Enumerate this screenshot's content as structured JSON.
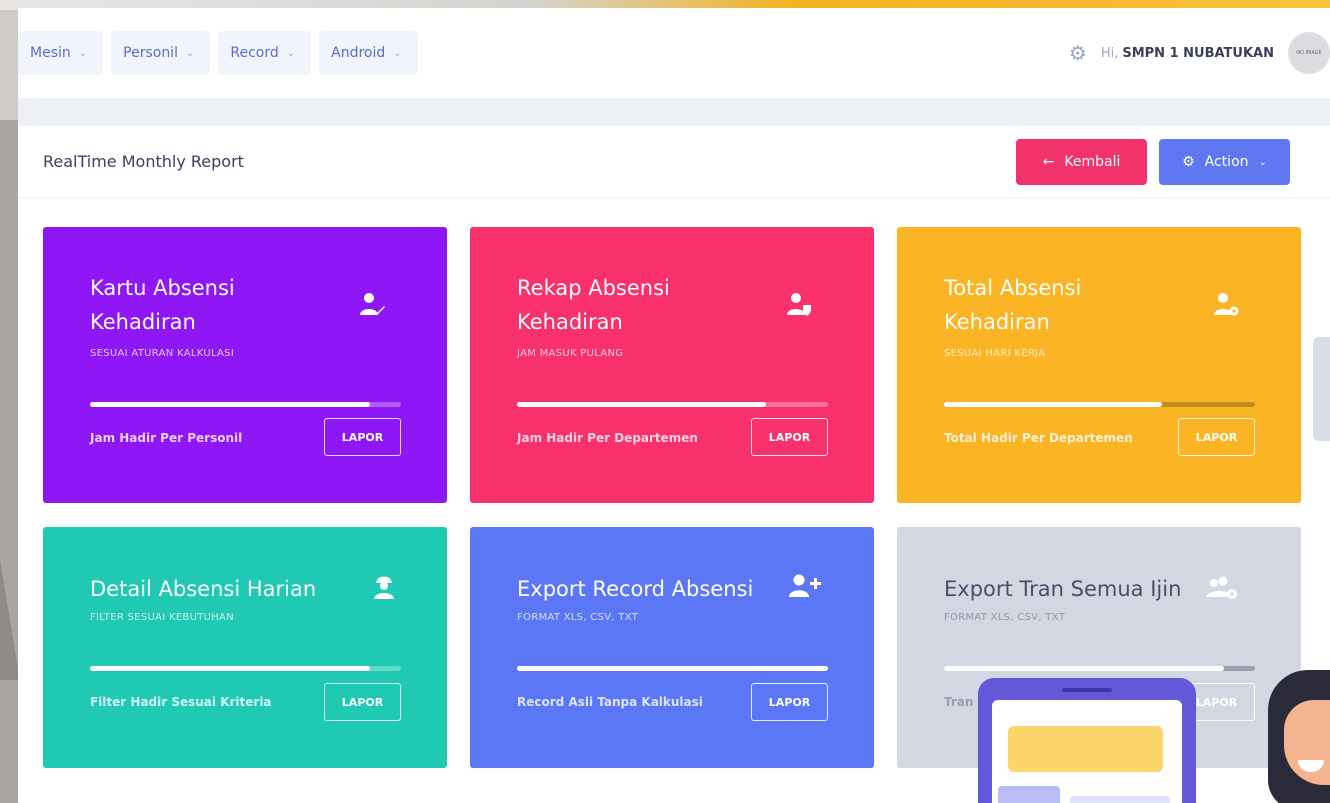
{
  "nav": {
    "menu": [
      {
        "label": "Mesin"
      },
      {
        "label": "Personil"
      },
      {
        "label": "Record"
      },
      {
        "label": "Android"
      }
    ],
    "greeting": "Hi,",
    "user_name": "SMPN 1 NUBATUKAN",
    "avatar_text": "NO IMAGE"
  },
  "page": {
    "title": "RealTime Monthly Report",
    "back_label": "Kembali",
    "action_label": "Action"
  },
  "cards": [
    {
      "title_line1": "Kartu Absensi",
      "title_line2": "Kehadiran",
      "subtitle": "SESUAI ATURAN KALKULASI",
      "footer": "Jam Hadir Per Personil",
      "button": "LAPOR",
      "progress": 0.9,
      "color": "#8f16f5",
      "icon": "user-edit-icon"
    },
    {
      "title_line1": "Rekap Absensi",
      "title_line2": "Kehadiran",
      "subtitle": "JAM MASUK PULANG",
      "footer": "Jam Hadir Per Departemen",
      "button": "LAPOR",
      "progress": 0.8,
      "color": "#f8306c",
      "icon": "user-shield-icon"
    },
    {
      "title_line1": "Total Absensi",
      "title_line2": "Kehadiran",
      "subtitle": "SESUAI HARI KERJA",
      "footer": "Total Hadir Per Departemen",
      "button": "LAPOR",
      "progress": 0.7,
      "color": "#fbb423",
      "icon": "user-cog-icon"
    },
    {
      "title_line1": "Detail Absensi Harian",
      "subtitle": "FILTER SESUAI KEBUTUHAN",
      "footer": "Filter Hadir Sesuai Kriteria",
      "button": "LAPOR",
      "progress": 0.9,
      "color": "#1fc9b4",
      "icon": "user-worker-icon"
    },
    {
      "title_line1": "Export Record Absensi",
      "subtitle": "FORMAT XLS, CSV, TXT",
      "footer": "Record Asli Tanpa Kalkulasi",
      "button": "LAPOR",
      "progress": 1.0,
      "color": "#5c77f6",
      "icon": "user-plus-icon"
    },
    {
      "title_line1": "Export Tran Semua Ijin",
      "subtitle": "FORMAT XLS, CSV, TXT",
      "footer": "Tran",
      "button": "LAPOR",
      "progress": 0.9,
      "color": "#d3d7e2",
      "icon": "users-cog-icon"
    }
  ]
}
